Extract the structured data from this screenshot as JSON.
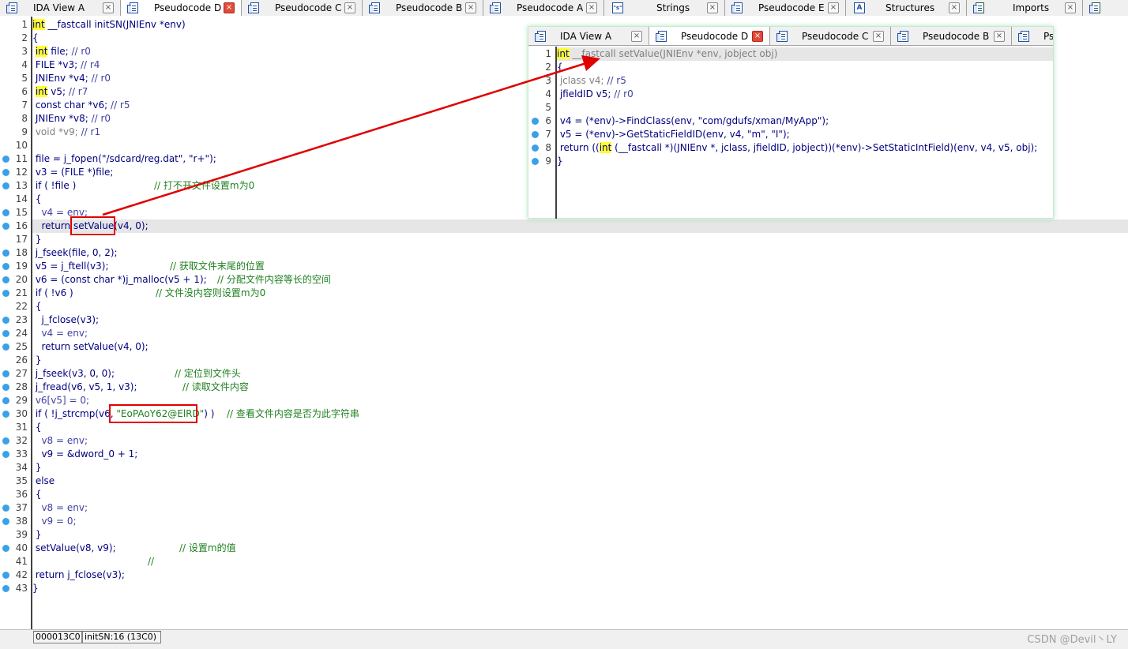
{
  "tabs": [
    {
      "label": "IDA View A",
      "icon": "ida-view-icon",
      "close_red": false
    },
    {
      "label": "Pseudocode D",
      "icon": "pseudocode-icon",
      "close_red": true
    },
    {
      "label": "Pseudocode C",
      "icon": "pseudocode-icon",
      "close_red": false
    },
    {
      "label": "Pseudocode B",
      "icon": "pseudocode-icon",
      "close_red": false
    },
    {
      "label": "Pseudocode A",
      "icon": "pseudocode-icon",
      "close_red": false
    },
    {
      "label": "Strings",
      "icon": "strings-icon",
      "close_red": false
    },
    {
      "label": "Pseudocode E",
      "icon": "pseudocode-icon",
      "close_red": false
    },
    {
      "label": "Structures",
      "icon": "structures-icon",
      "close_red": false
    },
    {
      "label": "Imports",
      "icon": "imports-icon",
      "close_red": false
    },
    {
      "label": "",
      "icon": "exports-icon",
      "close_red": false
    }
  ],
  "close_glyph": "×",
  "strings_glyph": "\"s\"",
  "structures_glyph": "A",
  "main_code": {
    "numbers": [
      "1",
      "2",
      "3",
      "4",
      "5",
      "6",
      "7",
      "8",
      "9",
      "10",
      "11",
      "12",
      "13",
      "14",
      "15",
      "16",
      "17",
      "18",
      "19",
      "20",
      "21",
      "22",
      "23",
      "24",
      "25",
      "26",
      "27",
      "28",
      "29",
      "30",
      "31",
      "32",
      "33",
      "34",
      "35",
      "36",
      "37",
      "38",
      "39",
      "40",
      "41",
      "42",
      "43"
    ],
    "l1": {
      "kw": "int",
      "rest": " __fastcall initSN(JNIEnv *env)"
    },
    "l2": "{",
    "l3": {
      "kw": "int",
      "a": " file; ",
      "c": "// r0"
    },
    "l4": {
      "a": " FILE *v3; ",
      "c": "// r4"
    },
    "l5": {
      "a": " JNIEnv *v4; ",
      "c": "// r0"
    },
    "l6": {
      "kw": "int",
      "a": " v5; ",
      "c": "// r7"
    },
    "l7": {
      "a": " const char *v6; ",
      "c": "// r5"
    },
    "l8": {
      "a": " JNIEnv *v8; ",
      "c": "// r0"
    },
    "l9": {
      "a": " void *v9; ",
      "c": "// r1"
    },
    "l11": {
      "a": " file = j_fopen(\"/sdcard/reg.dat\", \"r+\");"
    },
    "l12": {
      "a": " v3 = (FILE *)file;"
    },
    "l13": {
      "a": " if ( !file )",
      "c": "// 打不开文件设置m为0"
    },
    "l14": " {",
    "l15": {
      "a": "   v4 = env;"
    },
    "l16": {
      "a": "   return ",
      "b": "setValue",
      "d": "(v4, 0);"
    },
    "l17": " }",
    "l18": {
      "a": " j_fseek(file, 0, 2);"
    },
    "l19": {
      "a": " v5 = j_ftell(v3);",
      "c": "// 获取文件末尾的位置"
    },
    "l20": {
      "a": " v6 = (const char *)j_malloc(v5 + 1);",
      "c": "// 分配文件内容等长的空间"
    },
    "l21": {
      "a": " if ( !v6 )",
      "c": "// 文件没内容则设置m为0"
    },
    "l22": " {",
    "l23": {
      "a": "   j_fclose(v3);"
    },
    "l24": {
      "a": "   v4 = env;"
    },
    "l25": {
      "a": "   return setValue(v4, 0);"
    },
    "l26": " }",
    "l27": {
      "a": " j_fseek(v3, 0, 0);",
      "c": "// 定位到文件头"
    },
    "l28": {
      "a": " j_fread(v6, v5, 1, v3);",
      "c": "// 读取文件内容"
    },
    "l29": {
      "a": " v6[v5] = 0;"
    },
    "l30": {
      "a": " if ( !j_strcmp(v6, ",
      "b": "\"EoPAoY62@ElRD\"",
      "d": ") )",
      "c": "// 查看文件内容是否为此字符串"
    },
    "l31": " {",
    "l32": {
      "a": "   v8 = env;"
    },
    "l33": {
      "a": "   v9 = &dword_0 + 1;"
    },
    "l34": " }",
    "l35": " else",
    "l36": " {",
    "l37": {
      "a": "   v8 = env;"
    },
    "l38": {
      "a": "   v9 = 0;"
    },
    "l39": " }",
    "l40": {
      "a": " setValue(v8, v9);",
      "c": "// 设置m的值"
    },
    "l41": {
      "c": "//"
    },
    "l42": {
      "a": " return j_fclose(v3);"
    },
    "l43": "}"
  },
  "popup": {
    "tabs": [
      {
        "label": "IDA View A",
        "close_red": false
      },
      {
        "label": "Pseudocode D",
        "close_red": true
      },
      {
        "label": "Pseudocode C",
        "close_red": false
      },
      {
        "label": "Pseudocode B",
        "close_red": false
      },
      {
        "label": "Pse",
        "close_red": false
      }
    ],
    "numbers": [
      "1",
      "2",
      "3",
      "4",
      "5",
      "6",
      "7",
      "8",
      "9"
    ],
    "l1": {
      "kw": "int",
      "rest": " __fastcall setValue(JNIEnv *env, jobject obj)"
    },
    "l2": "{",
    "l3": {
      "a": " jclass v4; ",
      "c": "// r5"
    },
    "l4": {
      "a": " jfieldID v5; ",
      "c": "// r0"
    },
    "l6": {
      "a": " v4 = (*env)->FindClass(env, \"com/gdufs/xman/MyApp\");"
    },
    "l7": {
      "a": " v5 = (*env)->GetStaticFieldID(env, v4, \"m\", \"I\");"
    },
    "l8": {
      "a": " return ((",
      "kw": "int",
      "b": " (__fastcall *)(JNIEnv *, jclass, jfieldID, jobject))(*env)->SetStaticIntField)(env, v4, v5, obj);"
    },
    "l9": "}"
  },
  "status": {
    "address": "000013C0",
    "location": "initSN:16 (13C0)"
  },
  "watermark": "CSDN @Devil丶LY",
  "colors": {
    "annotation_red": "#e00000",
    "keyword_highlight": "#ffff30",
    "breakpoint_dot": "#3aa0e8",
    "comment_green": "#208020"
  }
}
